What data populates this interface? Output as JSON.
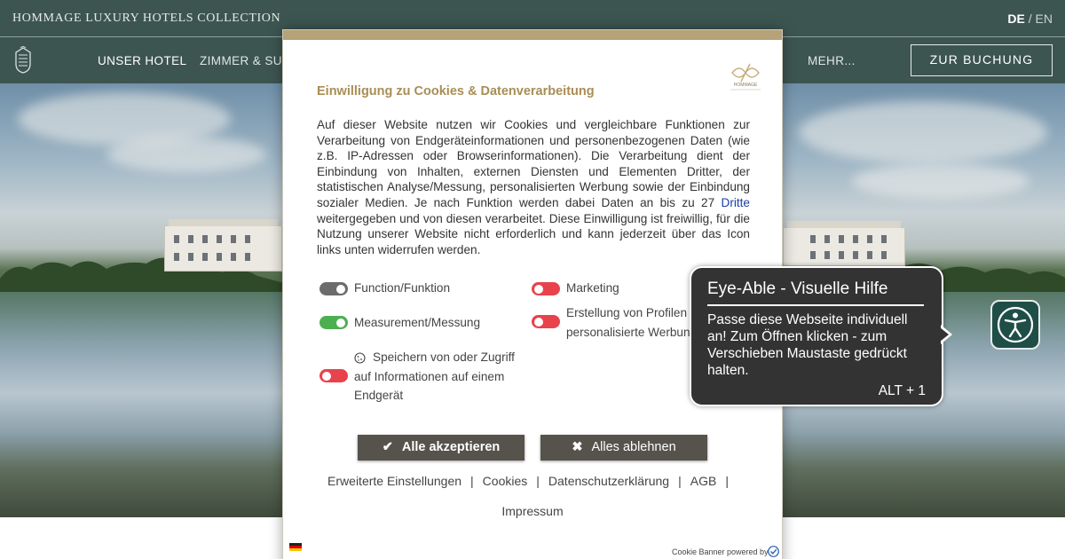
{
  "header": {
    "brand": "HOMMAGE LUXURY HOTELS COLLECTION",
    "lang_active": "DE",
    "lang_sep": " / ",
    "lang_other": "EN"
  },
  "nav": {
    "items": [
      "UNSER HOTEL",
      "ZIMMER & SUITE",
      "MEHR..."
    ],
    "booking": "ZUR BUCHUNG"
  },
  "cookie": {
    "title": "Einwilligung zu Cookies & Datenverarbeitung",
    "logo_text": "HOMMAGE",
    "text_before_link": "Auf dieser Website nutzen wir Cookies und vergleichbare Funktionen zur Verarbeitung von Endgeräteinformationen und personenbezogenen Daten (wie z.B. IP-Adressen oder Browserinformationen). Die Verarbeitung dient der Einbindung von Inhalten, externen Diensten und Elementen Dritter, der statistischen Analyse/Messung, personalisierten Werbung sowie der Einbindung sozialer Medien. Je nach Funktion werden dabei Daten an bis zu 27 ",
    "link_text": "Dritte",
    "text_after_link": " weitergegeben und von diesen verarbeitet. Diese Einwilligung ist freiwillig, für die Nutzung unserer Website nicht erforderlich und kann jederzeit über das Icon links unten widerrufen werden.",
    "options": {
      "function": "Function/Funktion",
      "measurement": "Measurement/Messung",
      "storage": "Speichern von oder Zugriff auf Informationen auf einem Endgerät",
      "marketing": "Marketing",
      "profiles": "Erstellung von Profilen für personalisierte Werbung"
    },
    "accept": "Alle akzeptieren",
    "reject": "Alles ablehnen",
    "links": [
      "Erweiterte Einstellungen",
      "Cookies",
      "Datenschutzerklärung",
      "AGB"
    ],
    "separator": "|",
    "impressum": "Impressum",
    "powered": "Cookie Banner powered by"
  },
  "eyeable": {
    "title": "Eye-Able - Visuelle Hilfe",
    "text": "Passe diese Webseite individuell an! Zum Öffnen klicken - zum Verschieben Maustaste gedrückt halten.",
    "shortcut": "ALT + 1"
  },
  "colors": {
    "nav_bg": "#3d5551",
    "gold": "#a88e55",
    "button_bg": "#56524c",
    "toggle_red": "#e8424c",
    "toggle_green": "#4caf50",
    "toggle_grey": "#6c6c6c",
    "tooltip_bg": "#333333",
    "eyeable_bg": "#1f4e47"
  }
}
